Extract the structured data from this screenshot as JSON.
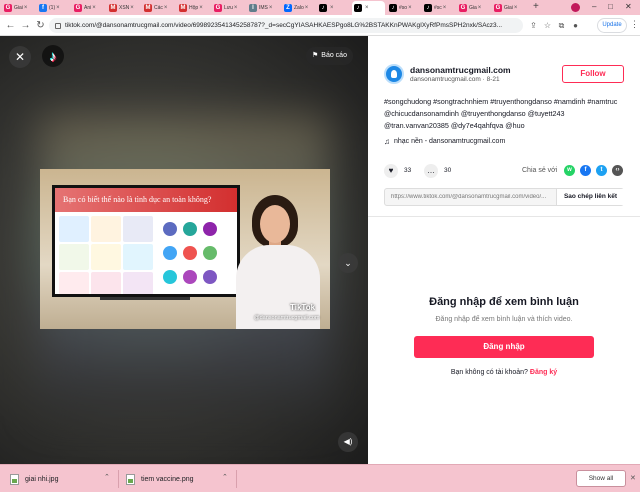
{
  "browser": {
    "tabs": [
      {
        "label": "Giai",
        "icon_color": "#e91e63",
        "icon_glyph": "G"
      },
      {
        "label": "(1)",
        "icon_color": "#1877f2",
        "icon_glyph": "f"
      },
      {
        "label": "Ani",
        "icon_color": "#e91e63",
        "icon_glyph": "G"
      },
      {
        "label": "XSN",
        "icon_color": "#d32f2f",
        "icon_glyph": "M"
      },
      {
        "label": "Các",
        "icon_color": "#d32f2f",
        "icon_glyph": "M"
      },
      {
        "label": "Hộp",
        "icon_color": "#d32f2f",
        "icon_glyph": "M"
      },
      {
        "label": "Lưu",
        "icon_color": "#e91e63",
        "icon_glyph": "G"
      },
      {
        "label": "IMS",
        "icon_color": "#607d8b",
        "icon_glyph": "I"
      },
      {
        "label": "Zalo",
        "icon_color": "#0068ff",
        "icon_glyph": "Z"
      },
      {
        "label": "",
        "icon_color": "#000000",
        "icon_glyph": "♪"
      },
      {
        "label": "",
        "icon_color": "#000000",
        "icon_glyph": "♪"
      },
      {
        "label": "#so",
        "icon_color": "#000000",
        "icon_glyph": "♪"
      },
      {
        "label": "#sc",
        "icon_color": "#000000",
        "icon_glyph": "♪"
      },
      {
        "label": "Gia",
        "icon_color": "#e91e63",
        "icon_glyph": "G"
      },
      {
        "label": "Giai",
        "icon_color": "#e91e63",
        "icon_glyph": "G"
      }
    ],
    "active_tab": 10,
    "new_tab_glyph": "+",
    "url": "tiktok.com/@dansonamtrucgmail.com/video/6998923541345258787?_d=secCgYIASAHKAESPgo8LG%2BSTAKKnPWAKgIXyRfPmsSPH2nxk/SAcz3...",
    "update_label": "Update",
    "window_controls": [
      "–",
      "□",
      "✕"
    ]
  },
  "video": {
    "close_glyph": "✕",
    "report_label": "Báo cáo",
    "slide_title": "Bạn có biết thế nào là tình dục an toàn không?",
    "watermark_logo": "TikTok",
    "watermark_user": "@dansonamtrucgmail.com",
    "next_glyph": "⌄",
    "volume_glyph": "◀)"
  },
  "post": {
    "username": "dansonamtrucgmail.com",
    "handle": "dansonamtrucgmail.com",
    "date": "8-21",
    "follow_label": "Follow",
    "caption": "#songchudong #songtrachnhiem #truyenthongdanso #namdinh #namtruc @chicucdansonamdinh @truyenthongdanso @tuyett243 @tran.vanvan20385 @dy7e4qahfqva @huo",
    "music": "nhạc nền - dansonamtrucgmail.com",
    "likes": "33",
    "comments": "30",
    "share_label": "Chia sẻ với",
    "share_targets": [
      {
        "name": "whatsapp-icon",
        "color": "#25d366",
        "glyph": "w"
      },
      {
        "name": "facebook-icon",
        "color": "#1877f2",
        "glyph": "f"
      },
      {
        "name": "twitter-icon",
        "color": "#1da1f2",
        "glyph": "t"
      },
      {
        "name": "embed-icon",
        "color": "#555555",
        "glyph": "‹›"
      }
    ],
    "link": "https://www.tiktok.com/@dansonamtrucgmail.com/video/...",
    "copy_label": "Sao chép liên kết"
  },
  "login": {
    "title": "Đăng nhập để xem bình luận",
    "subtitle": "Đăng nhập để xem bình luận và thích video.",
    "button": "Đăng nhập",
    "no_account": "Bạn không có tài khoản?",
    "signup": "Đăng ký"
  },
  "downloads": {
    "items": [
      {
        "name": "giai nhi.jpg"
      },
      {
        "name": "tiem vaccine.png"
      }
    ],
    "show_all": "Show all"
  },
  "colors": {
    "accent": "#fe2c55",
    "tabbar": "#f5c4cf"
  }
}
